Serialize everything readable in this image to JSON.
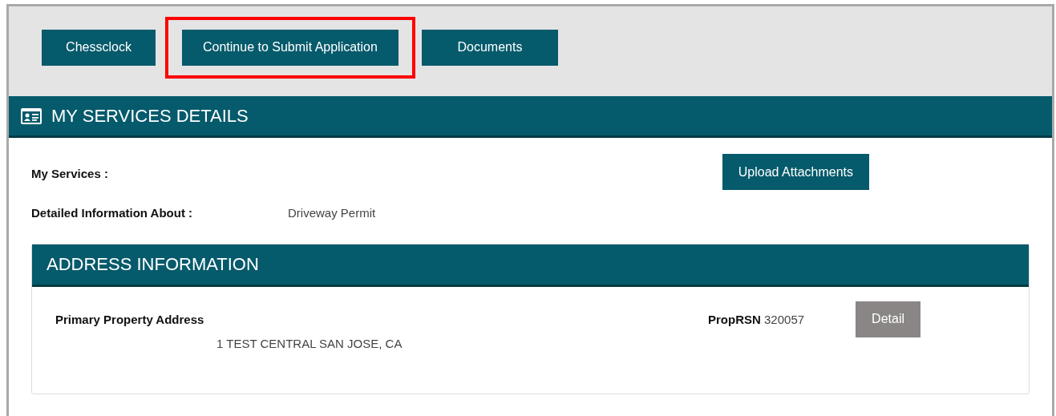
{
  "toolbar": {
    "buttons": [
      {
        "label": "Chessclock",
        "highlighted": false
      },
      {
        "label": "Continue to Submit Application",
        "highlighted": true
      },
      {
        "label": "Documents",
        "highlighted": false
      }
    ]
  },
  "section": {
    "title": "MY SERVICES DETAILS",
    "my_services_label": "My Services :",
    "upload_button": "Upload Attachments",
    "detail_label": "Detailed Information About :",
    "detail_value": "Driveway Permit",
    "address_card": {
      "title": "ADDRESS INFORMATION",
      "primary_label": "Primary Property Address",
      "address": "1 TEST CENTRAL SAN JOSE, CA",
      "prop_label": "PropRSN",
      "prop_value": "320057",
      "detail_button": "Detail"
    }
  }
}
